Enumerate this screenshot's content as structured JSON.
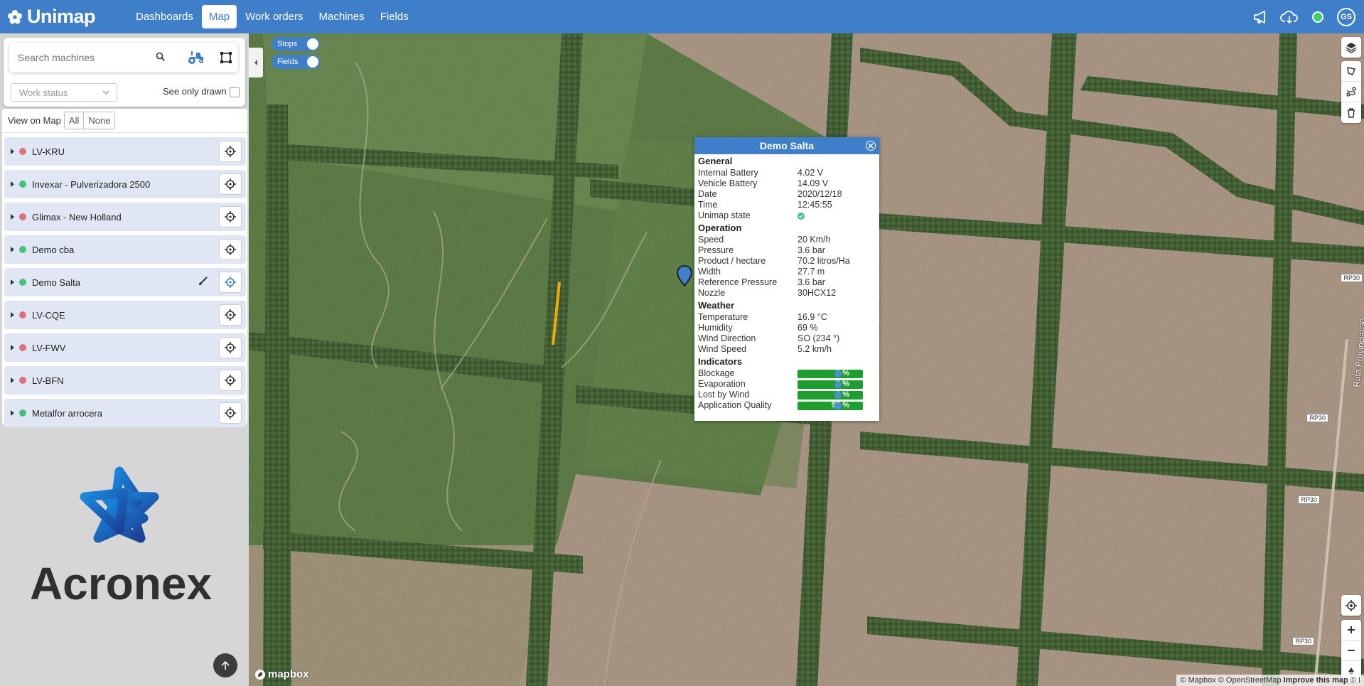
{
  "app": {
    "name": "Unimap",
    "nav": [
      {
        "label": "Dashboards",
        "active": false
      },
      {
        "label": "Map",
        "active": true
      },
      {
        "label": "Work orders",
        "active": false
      },
      {
        "label": "Machines",
        "active": false
      },
      {
        "label": "Fields",
        "active": false
      }
    ],
    "header_icons": [
      "megaphone-icon",
      "cloud-download-icon",
      "connection-status-icon"
    ],
    "user_initials": "GS"
  },
  "sidebar": {
    "search_placeholder": "Search machines",
    "work_status_placeholder": "Work status",
    "see_only_drawn": "See only drawn",
    "view_on_map": "View on Map",
    "all_label": "All",
    "none_label": "None",
    "machines": [
      {
        "name": "LV-KRU",
        "status": "red"
      },
      {
        "name": "Invexar - Pulverizadora 2500",
        "status": "green"
      },
      {
        "name": "Glimax - New Holland",
        "status": "red"
      },
      {
        "name": "Demo cba",
        "status": "green"
      },
      {
        "name": "Demo Salta",
        "status": "green",
        "selected": true
      },
      {
        "name": "LV-CQE",
        "status": "red"
      },
      {
        "name": "LV-FWV",
        "status": "red"
      },
      {
        "name": "LV-BFN",
        "status": "red"
      },
      {
        "name": "Metalfor arrocera",
        "status": "green"
      }
    ],
    "brand": "Acronex"
  },
  "map": {
    "stops_label": "Stops",
    "fields_label": "Fields",
    "mapbox_label": "mapbox",
    "attribution": "© Mapbox © OpenStreetMap",
    "improve": "Improve this map",
    "improve_suffix": "© I",
    "road_labels": [
      "RP30",
      "RP30",
      "RP30",
      "RP30"
    ],
    "road_name": "Ruta Provincial 30"
  },
  "popup": {
    "title": "Demo Salta",
    "general_label": "General",
    "general": [
      {
        "k": "Internal Battery",
        "v": "4.02 V"
      },
      {
        "k": "Vehicle Battery",
        "v": "14.09 V"
      },
      {
        "k": "Date",
        "v": "2020/12/18"
      },
      {
        "k": "Time",
        "v": "12:45:55"
      },
      {
        "k": "Unimap state",
        "v": ""
      }
    ],
    "operation_label": "Operation",
    "operation": [
      {
        "k": "Speed",
        "v": "20 Km/h"
      },
      {
        "k": "Pressure",
        "v": "3.6 bar"
      },
      {
        "k": "Product / hectare",
        "v": "70.2 litros/Ha"
      },
      {
        "k": "Width",
        "v": "27.7 m"
      },
      {
        "k": "Reference Pressure",
        "v": "3.6 bar"
      },
      {
        "k": "Nozzle",
        "v": "30HCX12"
      }
    ],
    "weather_label": "Weather",
    "weather": [
      {
        "k": "Temperature",
        "v": "16.9 °C"
      },
      {
        "k": "Humidity",
        "v": "69 %"
      },
      {
        "k": "Wind Direction",
        "v": "SO (234 °)"
      },
      {
        "k": "Wind Speed",
        "v": "5.2 km/h"
      }
    ],
    "indicators_label": "Indicators",
    "indicators": [
      {
        "k": "Blockage",
        "v": "0 %"
      },
      {
        "k": "Evaporation",
        "v": "3 %"
      },
      {
        "k": "Lost by Wind",
        "v": "0 %"
      },
      {
        "k": "Application Quality",
        "v": "97 %"
      }
    ]
  },
  "colors": {
    "primary": "#3f7fc9",
    "status_red": "#e0707a",
    "status_green": "#45c17a",
    "indicator_green": "#1e9e2e",
    "track": "#f2a80c"
  }
}
